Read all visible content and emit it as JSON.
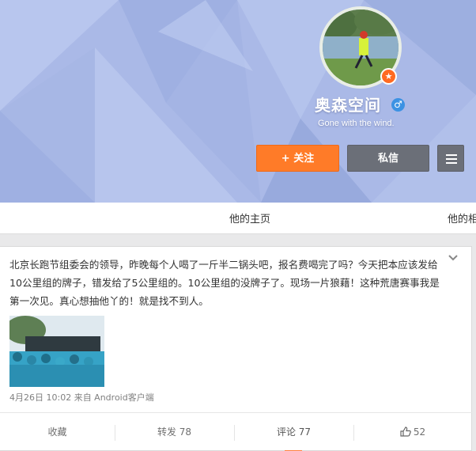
{
  "profile": {
    "name": "奥森空间",
    "bio": "Gone with the wind.",
    "gender_icon": "male-icon",
    "badge_icon": "verified-star-icon"
  },
  "buttons": {
    "follow": "+ 关注",
    "message": "私信",
    "more_icon": "menu-icon"
  },
  "tabs": [
    {
      "label": "他的主页"
    },
    {
      "label": "他的相"
    }
  ],
  "post": {
    "text": "北京长跑节组委会的领导，昨晚每个人喝了一斤半二锅头吧，报名费喝完了吗？今天把本应该发给10公里组的牌子，错发给了5公里组的。10公里组的没牌子了。现场一片狼藉！这种荒唐赛事我是第一次见。真心想抽他丫的！就是找不到人。",
    "meta": "4月26日 10:02 来自 Android客户端",
    "actions": {
      "favorite": "收藏",
      "repost": "转发 78",
      "comment": "评论 77",
      "like": "52"
    }
  },
  "colors": {
    "banner": "#a9b8e6",
    "follow_button": "#ff7b28",
    "dark_button": "#6b6f78",
    "accent": "#ff8140"
  }
}
